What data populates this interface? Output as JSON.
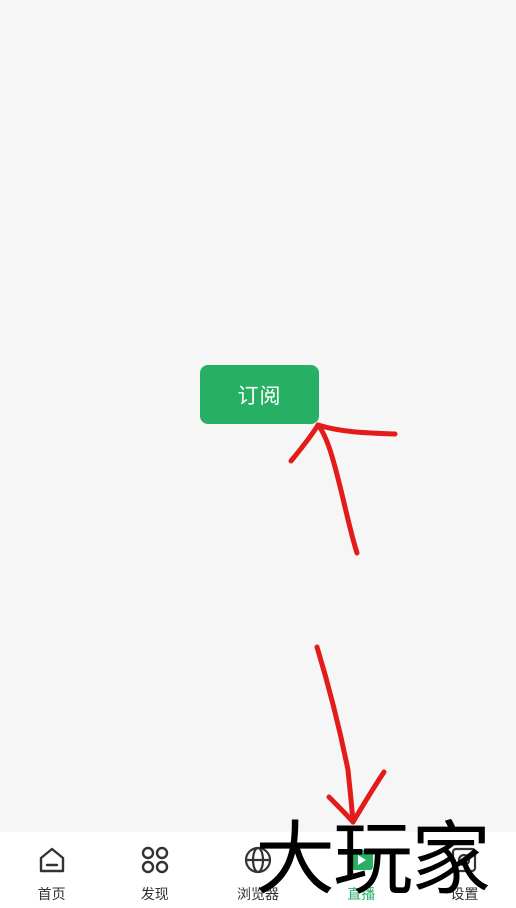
{
  "main": {
    "subscribe_label": "订阅"
  },
  "tabbar": {
    "tabs": [
      {
        "label": "首页",
        "icon": "home-icon"
      },
      {
        "label": "发现",
        "icon": "grid-icon"
      },
      {
        "label": "浏览器",
        "icon": "globe-icon"
      },
      {
        "label": "直播",
        "icon": "live-icon"
      },
      {
        "label": "设置",
        "icon": "gear-icon"
      }
    ],
    "active_tab": "直播"
  },
  "watermark": {
    "text": "大玩家"
  },
  "colors": {
    "accent": "#27b064",
    "annotation": "#e31b1b",
    "background": "#f6f6f6",
    "tabbar_background": "#ffffff",
    "text": "#333333"
  }
}
